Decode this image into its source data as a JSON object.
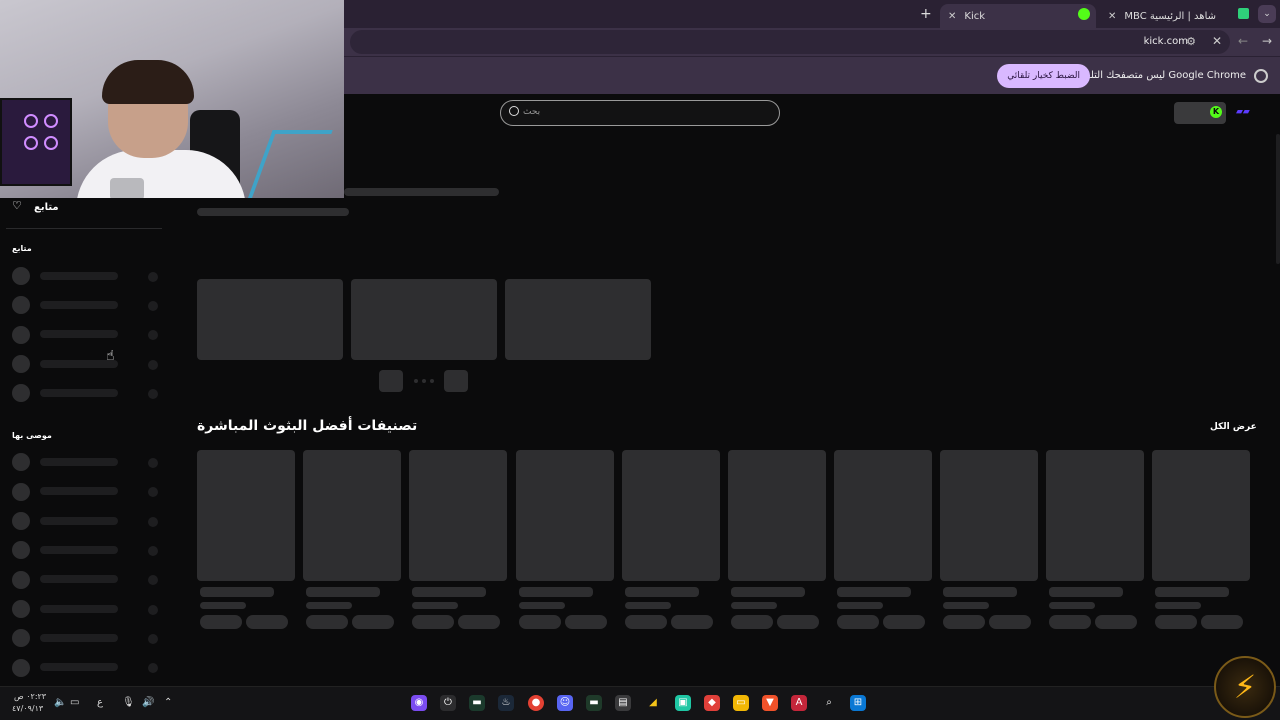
{
  "browser": {
    "tabs": [
      {
        "title": "MBC شاهد | الرئيسية",
        "active": false
      },
      {
        "title": "Kick",
        "active": true
      }
    ],
    "url": "kick.com",
    "infobar": {
      "message": "Google Chrome ليس متصفحك التلقائي",
      "button_label": "الضبط كخيار تلقائي"
    }
  },
  "page": {
    "search_placeholder": "بحث",
    "kick_badge": "K",
    "sidebar": {
      "followed_heading": "متابع",
      "section_1_label": "متابع",
      "section_2_label": "موصى بها"
    },
    "section_title": "تصنيفات أفضل البثوث المباشرة",
    "view_all_label": "عرض الكل"
  },
  "taskbar": {
    "time": "٠٢:٢٣ ص",
    "date": "٤٧/٠٩/١٣",
    "lang": "ع"
  },
  "colors": {
    "accent": "#53fc18",
    "chrome_frame": "#3c3147",
    "infobar_button": "#d9b8ff",
    "skeleton": "#2e2e30"
  }
}
